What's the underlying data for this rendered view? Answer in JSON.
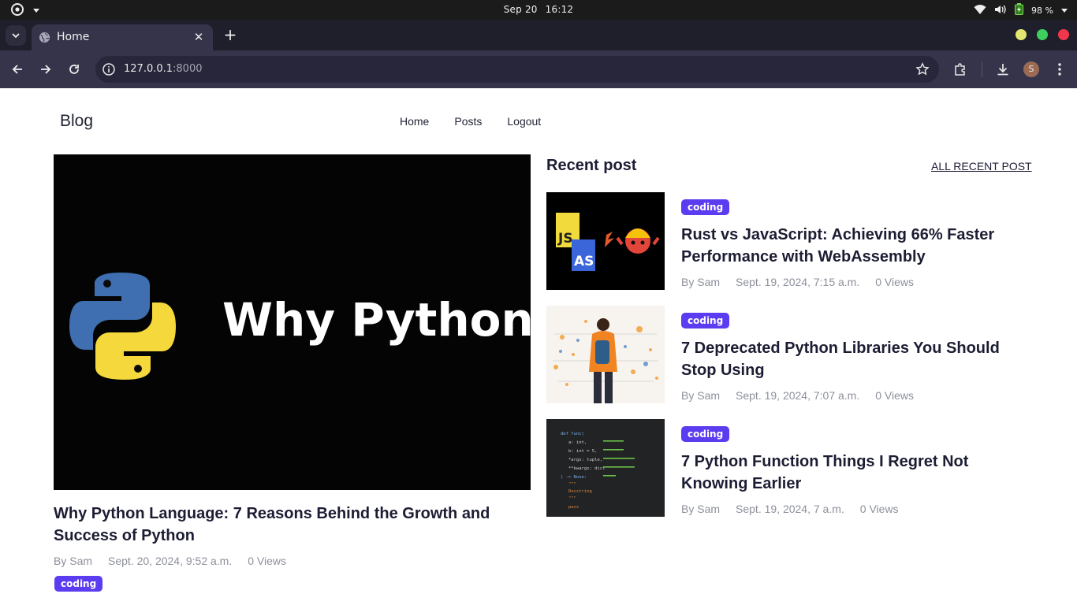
{
  "os": {
    "date": "Sep 20",
    "time": "16:12",
    "battery": "98 %"
  },
  "browser": {
    "tab_title": "Home",
    "url_host": "127.0.0.1",
    "url_port": ":8000",
    "profile_initial": "S"
  },
  "site": {
    "brand": "Blog",
    "nav": [
      "Home",
      "Posts",
      "Logout"
    ]
  },
  "featured": {
    "image_text": "Why Python?",
    "title": "Why Python Language: 7 Reasons Behind the Growth and Success of Python",
    "author": "By Sam",
    "date": "Sept. 20, 2024, 9:52 a.m.",
    "views": "0 Views",
    "category": "coding"
  },
  "recent": {
    "heading": "Recent post",
    "all_link": "ALL RECENT POST",
    "posts": [
      {
        "category": "coding",
        "title": "Rust vs JavaScript: Achieving 66% Faster Performance with WebAssembly",
        "author": "By Sam",
        "date": "Sept. 19, 2024, 7:15 a.m.",
        "views": "0 Views",
        "thumb_text": [
          "JS",
          "AS"
        ]
      },
      {
        "category": "coding",
        "title": "7 Deprecated Python Libraries You Should Stop Using",
        "author": "By Sam",
        "date": "Sept. 19, 2024, 7:07 a.m.",
        "views": "0 Views"
      },
      {
        "category": "coding",
        "title": "7 Python Function Things I Regret Not Knowing Earlier",
        "author": "By Sam",
        "date": "Sept. 19, 2024, 7 a.m.",
        "views": "0 Views",
        "thumb_code": [
          "def func(",
          "a: int,",
          "b: int = 5,",
          "*args: tuple,",
          "**kwargs: dict",
          ") -> None:",
          "\"\"\"",
          "Docstring",
          "\"\"\"",
          "pass"
        ]
      }
    ]
  },
  "colors": {
    "badge": "#5c3cf0",
    "tab_active": "#35344a",
    "tab_strip": "#1f1e2b"
  }
}
